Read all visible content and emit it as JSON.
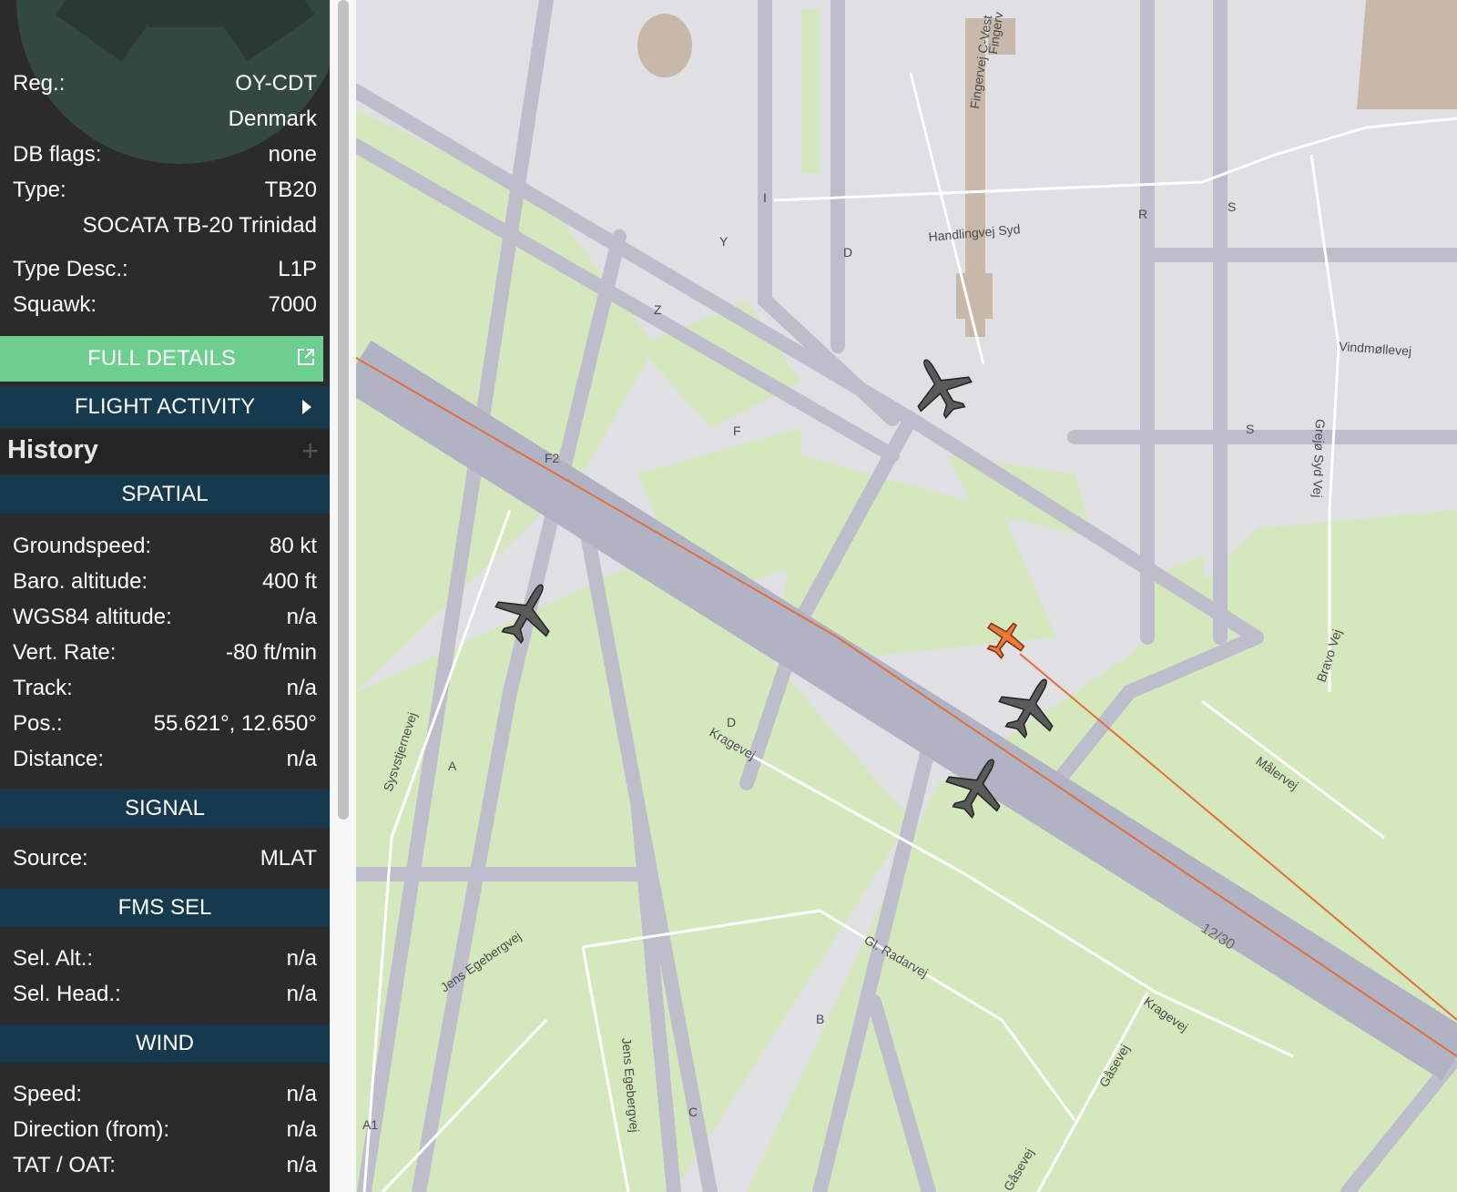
{
  "details": {
    "reg_label": "Reg.:",
    "reg_value": "OY-CDT",
    "country": "Denmark",
    "db_flags_label": "DB flags:",
    "db_flags_value": "none",
    "type_label": "Type:",
    "type_value": "TB20",
    "type_full": "SOCATA TB-20 Trinidad",
    "type_desc_label": "Type Desc.:",
    "type_desc_value": "L1P",
    "squawk_label": "Squawk:",
    "squawk_value": "7000"
  },
  "buttons": {
    "full_details": "FULL DETAILS",
    "flight_activity": "FLIGHT ACTIVITY"
  },
  "history": {
    "title": "History",
    "expand_icon": "plus-icon"
  },
  "spatial": {
    "header": "SPATIAL",
    "rows": [
      {
        "label": "Groundspeed:",
        "value": "80 kt"
      },
      {
        "label": "Baro. altitude:",
        "value": "400 ft"
      },
      {
        "label": "WGS84 altitude:",
        "value": "n/a"
      },
      {
        "label": "Vert. Rate:",
        "value": "-80 ft/min"
      },
      {
        "label": "Track:",
        "value": "n/a"
      },
      {
        "label": "Pos.:",
        "value": "55.621°, 12.650°"
      },
      {
        "label": "Distance:",
        "value": "n/a"
      }
    ]
  },
  "signal": {
    "header": "SIGNAL",
    "rows": [
      {
        "label": "Source:",
        "value": "MLAT"
      }
    ]
  },
  "fms": {
    "header": "FMS SEL",
    "rows": [
      {
        "label": "Sel. Alt.:",
        "value": "n/a"
      },
      {
        "label": "Sel. Head.:",
        "value": "n/a"
      }
    ]
  },
  "wind": {
    "header": "WIND",
    "rows": [
      {
        "label": "Speed:",
        "value": "n/a"
      },
      {
        "label": "Direction (from):",
        "value": "n/a"
      },
      {
        "label": "TAT / OAT:",
        "value": "n/a"
      }
    ]
  },
  "map": {
    "labels": {
      "handlingvej": "Handlingvej Syd",
      "fingervej": "Fingervej C-Vest",
      "fingerv": "Fingerv",
      "vindmollevej": "Vindmøllevej",
      "grejo": "Grejø Syd Vej",
      "bravo": "Bravo Vej",
      "malervej": "Målervej",
      "kragevej1": "Kragevej",
      "kragevej2": "Kragevej",
      "radarvej": "Gl. Radarvej",
      "gasevej": "Gåsevej",
      "gasevej2": "Gåsevej",
      "runway": "12/30",
      "jens1": "Jens Egebergvej",
      "jens2": "Jens Egebergvej",
      "systjernevej": "Sysvstjernevej",
      "f2": "F2",
      "twy_y": "Y",
      "twy_z": "Z",
      "twy_f": "F",
      "twy_d": "D",
      "twy_d2": "D",
      "twy_r": "R",
      "twy_s": "S",
      "twy_s2": "S",
      "twy_a": "A",
      "twy_b": "B",
      "twy_c": "C",
      "twy_a1": "A1",
      "twy_i": "I"
    },
    "colors": {
      "apron": "#e0dfe4",
      "grass": "#d5e8bd",
      "taxiway": "#bdbdcc",
      "runway": "#b2b2c5",
      "building": "#c8b8a9",
      "selected_aircraft": "#e87a3a",
      "other_aircraft": "#5a5a5a",
      "track_line": "#e0703a"
    }
  }
}
